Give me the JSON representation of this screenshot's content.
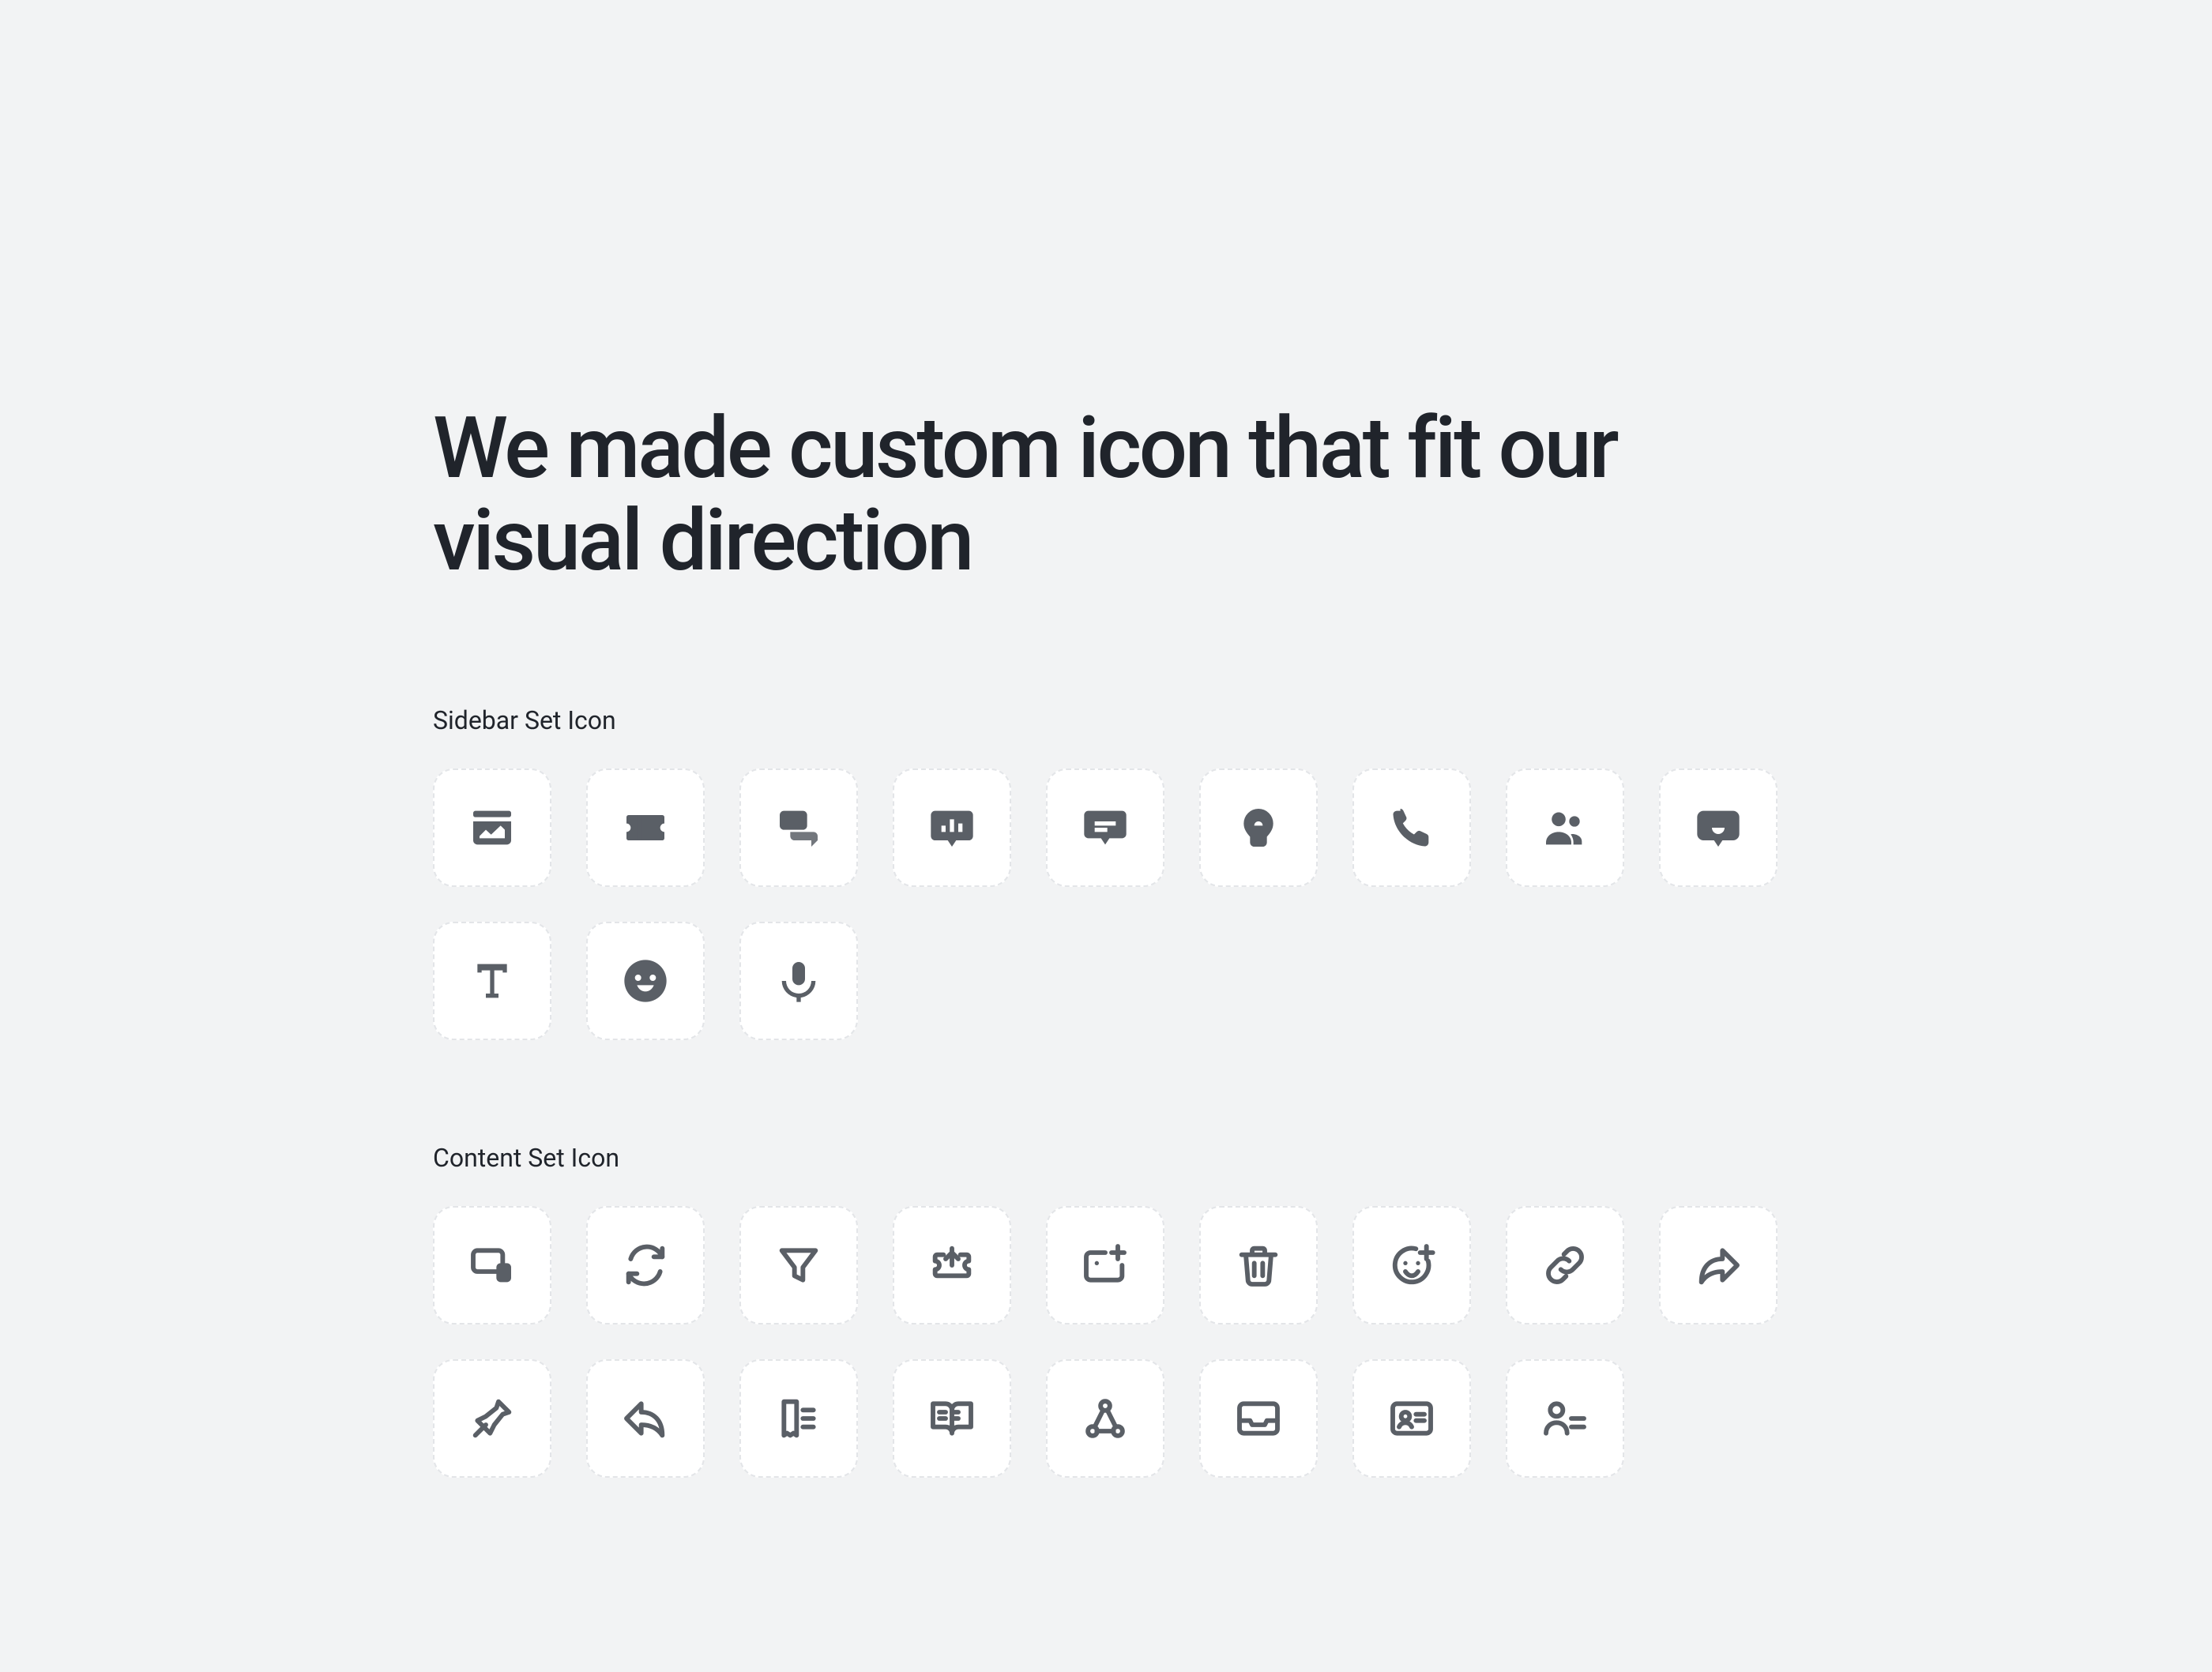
{
  "headline": "We made custom icon that fit our visual direction",
  "sidebar_label": "Sidebar Set Icon",
  "content_label": "Content Set Icon",
  "sidebar_icons": [
    "card-chart-icon",
    "ticket-icon",
    "chats-icon",
    "chart-bars-icon",
    "comment-icon",
    "lightbulb-icon",
    "phone-icon",
    "people-icon",
    "chat-bubble-icon",
    "text-icon",
    "smiley-icon",
    "mic-icon"
  ],
  "content_icons": [
    "devices-icon",
    "refresh-icon",
    "filter-icon",
    "ticket-out-icon",
    "image-add-icon",
    "trash-icon",
    "smiley-add-icon",
    "link-icon",
    "share-icon",
    "pin-icon",
    "reply-icon",
    "receipt-list-icon",
    "book-open-icon",
    "nodes-icon",
    "inbox-icon",
    "id-card-icon",
    "user-list-icon"
  ]
}
